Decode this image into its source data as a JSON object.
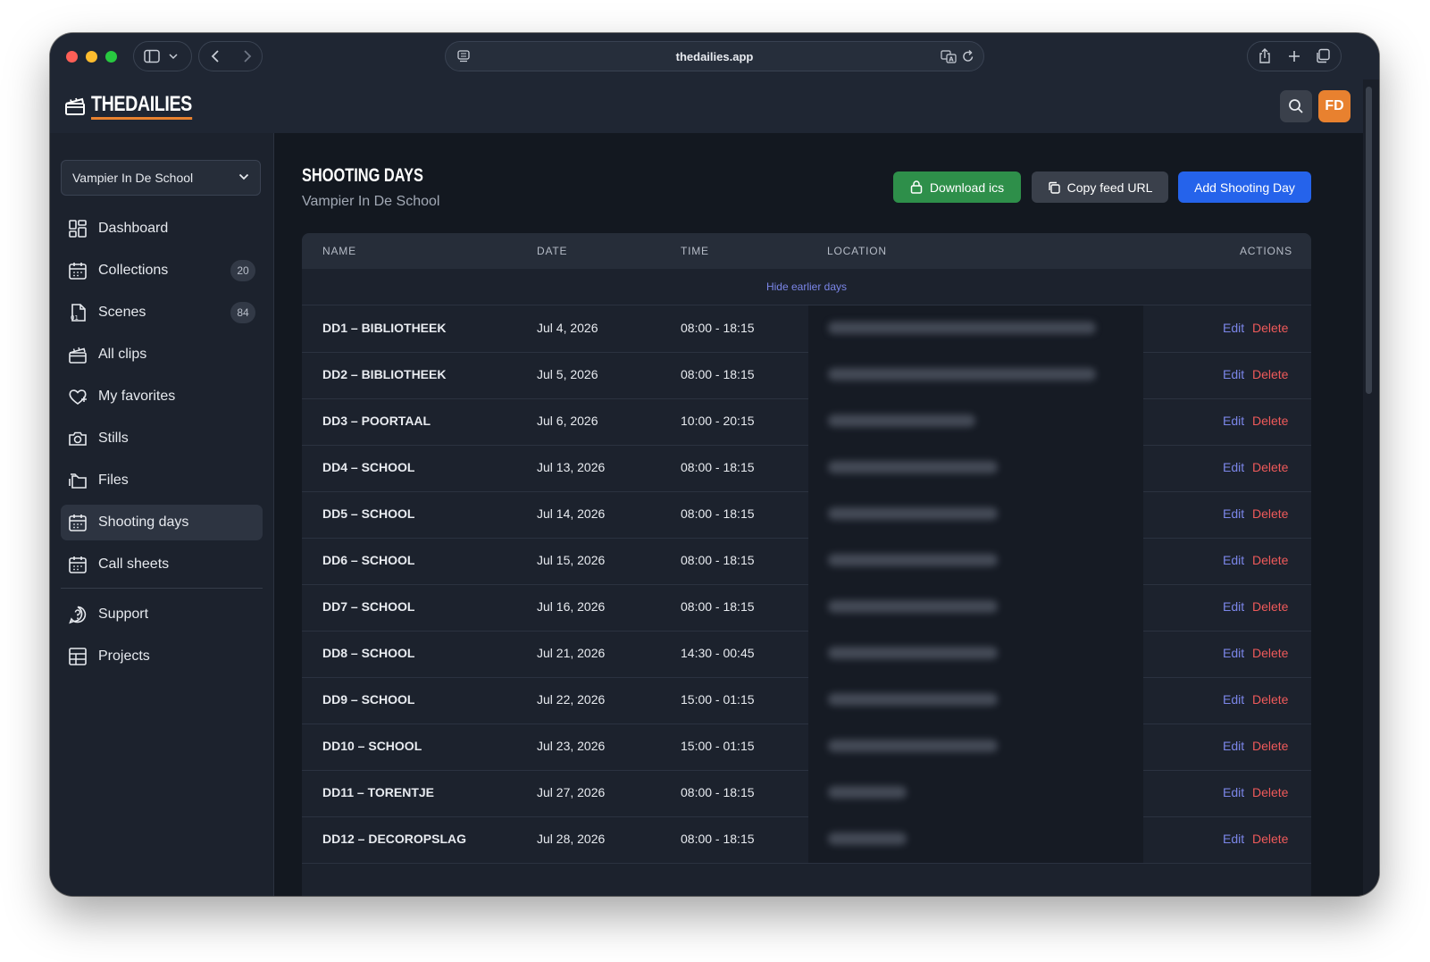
{
  "browser": {
    "url": "thedailies.app"
  },
  "header": {
    "logo_text": "THEDAILIES",
    "avatar_initials": "FD"
  },
  "sidebar": {
    "project_select": "Vampier In De School",
    "items": [
      {
        "label": "Dashboard",
        "icon": "dashboard-icon"
      },
      {
        "label": "Collections",
        "icon": "calendar-icon",
        "count": "20"
      },
      {
        "label": "Scenes",
        "icon": "scenes-icon",
        "count": "84"
      },
      {
        "label": "All clips",
        "icon": "clapperboard-icon"
      },
      {
        "label": "My favorites",
        "icon": "heart-icon"
      },
      {
        "label": "Stills",
        "icon": "camera-icon"
      },
      {
        "label": "Files",
        "icon": "folder-icon"
      },
      {
        "label": "Shooting days",
        "icon": "calendar-icon",
        "active": true
      },
      {
        "label": "Call sheets",
        "icon": "calendar-icon"
      },
      {
        "label": "Support",
        "icon": "support-icon"
      },
      {
        "label": "Projects",
        "icon": "grid-icon"
      }
    ]
  },
  "main": {
    "title": "SHOOTING DAYS",
    "subtitle": "Vampier In De School",
    "buttons": {
      "download": "Download ics",
      "copy": "Copy feed URL",
      "add": "Add Shooting Day"
    },
    "table": {
      "columns": [
        "NAME",
        "DATE",
        "TIME",
        "LOCATION",
        "ACTIONS"
      ],
      "hide_earlier": "Hide earlier days",
      "edit_label": "Edit",
      "delete_label": "Delete",
      "rows": [
        {
          "name": "DD1 – BIBLIOTHEEK",
          "date": "Jul 4, 2026",
          "time": "08:00 - 18:15"
        },
        {
          "name": "DD2 – BIBLIOTHEEK",
          "date": "Jul 5, 2026",
          "time": "08:00 - 18:15"
        },
        {
          "name": "DD3 – POORTAAL",
          "date": "Jul 6, 2026",
          "time": "10:00 - 20:15"
        },
        {
          "name": "DD4 – SCHOOL",
          "date": "Jul 13, 2026",
          "time": "08:00 - 18:15"
        },
        {
          "name": "DD5 – SCHOOL",
          "date": "Jul 14, 2026",
          "time": "08:00 - 18:15"
        },
        {
          "name": "DD6 – SCHOOL",
          "date": "Jul 15, 2026",
          "time": "08:00 - 18:15"
        },
        {
          "name": "DD7 – SCHOOL",
          "date": "Jul 16, 2026",
          "time": "08:00 - 18:15"
        },
        {
          "name": "DD8 – SCHOOL",
          "date": "Jul 21, 2026",
          "time": "14:30 - 00:45"
        },
        {
          "name": "DD9 – SCHOOL",
          "date": "Jul 22, 2026",
          "time": "15:00 - 01:15"
        },
        {
          "name": "DD10 – SCHOOL",
          "date": "Jul 23, 2026",
          "time": "15:00 - 01:15"
        },
        {
          "name": "DD11 – TORENTJE",
          "date": "Jul 27, 2026",
          "time": "08:00 - 18:15"
        },
        {
          "name": "DD12 – DECOROPSLAG",
          "date": "Jul 28, 2026",
          "time": "08:00 - 18:15"
        }
      ]
    }
  },
  "colors": {
    "accent_orange": "#e8812f",
    "button_green": "#2e8f4a",
    "button_blue": "#2563eb",
    "edit_link": "#7b86e8",
    "delete_link": "#ef5a5a"
  }
}
